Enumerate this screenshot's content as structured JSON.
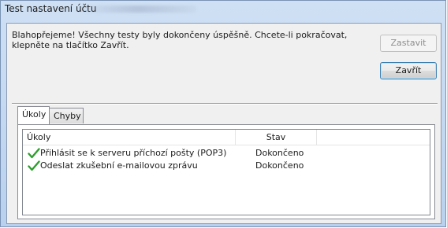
{
  "window": {
    "title": "Test nastavení účtu"
  },
  "message": "Blahopřejeme! Všechny testy byly dokončeny úspěšně. Chcete-li pokračovat, klepněte na tlačítko Zavřít.",
  "buttons": {
    "stop_label": "Zastavit",
    "close_label": "Zavřít"
  },
  "tabs": [
    {
      "label": "Úkoly",
      "active": true
    },
    {
      "label": "Chyby",
      "active": false
    }
  ],
  "table": {
    "columns": [
      "Úkoly",
      "Stav"
    ],
    "rows": [
      {
        "task": "Přihlásit se k serveru příchozí pošty (POP3)",
        "status": "Dokončeno",
        "icon": "green-check-icon"
      },
      {
        "task": "Odeslat zkušební e-mailovou zprávu",
        "status": "Dokončeno",
        "icon": "green-check-icon"
      }
    ]
  },
  "colors": {
    "check": "#2e9e2e",
    "default_button_border": "#3c7fb1",
    "title_bar": "#c4d8f0"
  }
}
